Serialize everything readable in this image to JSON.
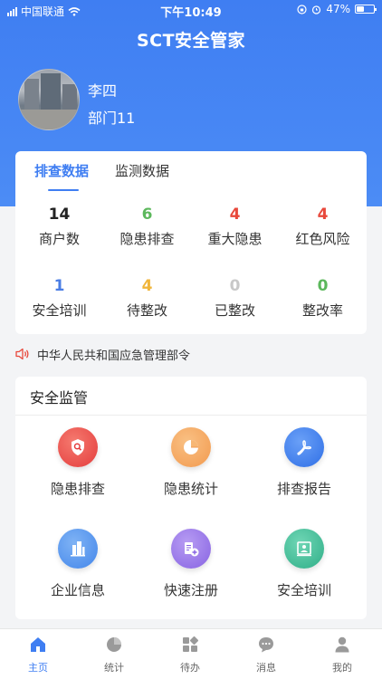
{
  "status_bar": {
    "carrier": "中国联通",
    "time": "下午10:49",
    "battery": "47%",
    "battery_level": 0.47
  },
  "app": {
    "title": "SCT安全管家"
  },
  "user": {
    "name": "李四",
    "department": "部门11"
  },
  "stats_tabs": [
    {
      "label": "排查数据",
      "active": true
    },
    {
      "label": "监测数据",
      "active": false
    }
  ],
  "stats": [
    {
      "value": "14",
      "label": "商户数",
      "color": "#222222"
    },
    {
      "value": "6",
      "label": "隐患排查",
      "color": "#5cb85c"
    },
    {
      "value": "4",
      "label": "重大隐患",
      "color": "#e8483b"
    },
    {
      "value": "4",
      "label": "红色风险",
      "color": "#e8483b"
    },
    {
      "value": "1",
      "label": "安全培训",
      "color": "#4a7de4"
    },
    {
      "value": "4",
      "label": "待整改",
      "color": "#f0b53a"
    },
    {
      "value": "0",
      "label": "已整改",
      "color": "#c8c8c8"
    },
    {
      "value": "0",
      "label": "整改率",
      "color": "#5cb85c"
    }
  ],
  "notice": {
    "icon": "speaker-icon",
    "text": "中华人民共和国应急管理部令"
  },
  "safety_section": {
    "title": "安全监管",
    "items": [
      {
        "label": "隐患排查",
        "icon": "shield-search-icon",
        "color": "#e94e4e"
      },
      {
        "label": "隐患统计",
        "icon": "pie-chart-icon",
        "color": "#f4a55a"
      },
      {
        "label": "排查报告",
        "icon": "pdf-icon",
        "color": "#3f7ef2"
      },
      {
        "label": "企业信息",
        "icon": "building-icon",
        "color": "#4e95ec"
      },
      {
        "label": "快速注册",
        "icon": "register-icon",
        "color": "#9b7be6"
      },
      {
        "label": "安全培训",
        "icon": "training-icon",
        "color": "#3fbf9a"
      }
    ]
  },
  "tabbar": [
    {
      "label": "主页",
      "icon": "home-icon",
      "active": true
    },
    {
      "label": "统计",
      "icon": "pie-chart-icon",
      "active": false
    },
    {
      "label": "待办",
      "icon": "grid-icon",
      "active": false
    },
    {
      "label": "消息",
      "icon": "chat-icon",
      "active": false
    },
    {
      "label": "我的",
      "icon": "user-icon",
      "active": false
    }
  ],
  "colors": {
    "primary": "#3f7ef2",
    "background": "#f3f4f6"
  }
}
